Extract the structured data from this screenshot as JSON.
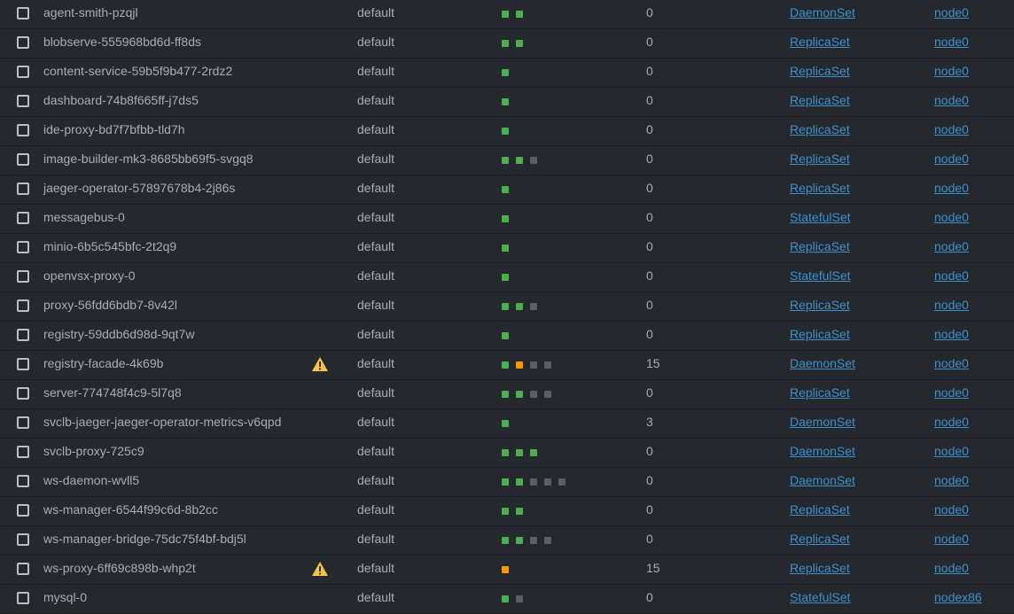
{
  "pods": [
    {
      "name": "agent-smith-pzqjl",
      "namespace": "default",
      "containers": [
        "ready",
        "ready"
      ],
      "restarts": "0",
      "controlled_by": "DaemonSet",
      "node": "node0",
      "warning": false
    },
    {
      "name": "blobserve-555968bd6d-ff8ds",
      "namespace": "default",
      "containers": [
        "ready",
        "ready"
      ],
      "restarts": "0",
      "controlled_by": "ReplicaSet",
      "node": "node0",
      "warning": false
    },
    {
      "name": "content-service-59b5f9b477-2rdz2",
      "namespace": "default",
      "containers": [
        "ready"
      ],
      "restarts": "0",
      "controlled_by": "ReplicaSet",
      "node": "node0",
      "warning": false
    },
    {
      "name": "dashboard-74b8f665ff-j7ds5",
      "namespace": "default",
      "containers": [
        "ready"
      ],
      "restarts": "0",
      "controlled_by": "ReplicaSet",
      "node": "node0",
      "warning": false
    },
    {
      "name": "ide-proxy-bd7f7bfbb-tld7h",
      "namespace": "default",
      "containers": [
        "ready"
      ],
      "restarts": "0",
      "controlled_by": "ReplicaSet",
      "node": "node0",
      "warning": false
    },
    {
      "name": "image-builder-mk3-8685bb69f5-svgq8",
      "namespace": "default",
      "containers": [
        "ready",
        "ready",
        "off"
      ],
      "restarts": "0",
      "controlled_by": "ReplicaSet",
      "node": "node0",
      "warning": false
    },
    {
      "name": "jaeger-operator-57897678b4-2j86s",
      "namespace": "default",
      "containers": [
        "ready"
      ],
      "restarts": "0",
      "controlled_by": "ReplicaSet",
      "node": "node0",
      "warning": false
    },
    {
      "name": "messagebus-0",
      "namespace": "default",
      "containers": [
        "ready"
      ],
      "restarts": "0",
      "controlled_by": "StatefulSet",
      "node": "node0",
      "warning": false
    },
    {
      "name": "minio-6b5c545bfc-2t2q9",
      "namespace": "default",
      "containers": [
        "ready"
      ],
      "restarts": "0",
      "controlled_by": "ReplicaSet",
      "node": "node0",
      "warning": false
    },
    {
      "name": "openvsx-proxy-0",
      "namespace": "default",
      "containers": [
        "ready"
      ],
      "restarts": "0",
      "controlled_by": "StatefulSet",
      "node": "node0",
      "warning": false
    },
    {
      "name": "proxy-56fdd6bdb7-8v42l",
      "namespace": "default",
      "containers": [
        "ready",
        "ready",
        "off"
      ],
      "restarts": "0",
      "controlled_by": "ReplicaSet",
      "node": "node0",
      "warning": false
    },
    {
      "name": "registry-59ddb6d98d-9qt7w",
      "namespace": "default",
      "containers": [
        "ready"
      ],
      "restarts": "0",
      "controlled_by": "ReplicaSet",
      "node": "node0",
      "warning": false
    },
    {
      "name": "registry-facade-4k69b",
      "namespace": "default",
      "containers": [
        "ready",
        "warning",
        "off",
        "off"
      ],
      "restarts": "15",
      "controlled_by": "DaemonSet",
      "node": "node0",
      "warning": true
    },
    {
      "name": "server-774748f4c9-5l7q8",
      "namespace": "default",
      "containers": [
        "ready",
        "ready",
        "off",
        "off"
      ],
      "restarts": "0",
      "controlled_by": "ReplicaSet",
      "node": "node0",
      "warning": false
    },
    {
      "name": "svclb-jaeger-jaeger-operator-metrics-v6qpd",
      "namespace": "default",
      "containers": [
        "ready"
      ],
      "restarts": "3",
      "controlled_by": "DaemonSet",
      "node": "node0",
      "warning": false
    },
    {
      "name": "svclb-proxy-725c9",
      "namespace": "default",
      "containers": [
        "ready",
        "ready",
        "ready"
      ],
      "restarts": "0",
      "controlled_by": "DaemonSet",
      "node": "node0",
      "warning": false
    },
    {
      "name": "ws-daemon-wvll5",
      "namespace": "default",
      "containers": [
        "ready",
        "ready",
        "off",
        "off",
        "off"
      ],
      "restarts": "0",
      "controlled_by": "DaemonSet",
      "node": "node0",
      "warning": false
    },
    {
      "name": "ws-manager-6544f99c6d-8b2cc",
      "namespace": "default",
      "containers": [
        "ready",
        "ready"
      ],
      "restarts": "0",
      "controlled_by": "ReplicaSet",
      "node": "node0",
      "warning": false
    },
    {
      "name": "ws-manager-bridge-75dc75f4bf-bdj5l",
      "namespace": "default",
      "containers": [
        "ready",
        "ready",
        "off",
        "off"
      ],
      "restarts": "0",
      "controlled_by": "ReplicaSet",
      "node": "node0",
      "warning": false
    },
    {
      "name": "ws-proxy-6ff69c898b-whp2t",
      "namespace": "default",
      "containers": [
        "warning"
      ],
      "restarts": "15",
      "controlled_by": "ReplicaSet",
      "node": "node0",
      "warning": true
    },
    {
      "name": "mysql-0",
      "namespace": "default",
      "containers": [
        "ready",
        "off"
      ],
      "restarts": "0",
      "controlled_by": "StatefulSet",
      "node": "nodex86",
      "warning": false
    }
  ],
  "colors": {
    "ready": "#4caf50",
    "warning": "#ff9800",
    "off": "#5a5f64",
    "link": "#3d90ce",
    "background": "#25282c"
  }
}
